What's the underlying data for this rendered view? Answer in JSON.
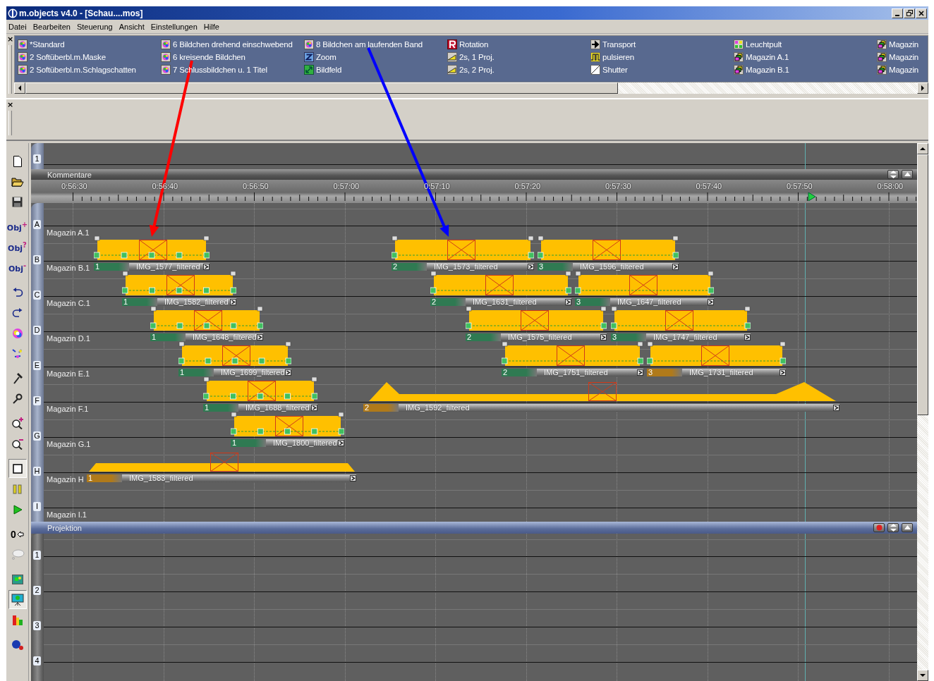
{
  "window": {
    "title": "m.objects v4.0 - [Schau....mos]"
  },
  "menu": [
    "Datei",
    "Bearbeiten",
    "Steuerung",
    "Ansicht",
    "Einstellungen",
    "Hilfe"
  ],
  "palette": {
    "close": "×",
    "columns": [
      [
        {
          "label": "*Standard"
        },
        {
          "label": "2 Softüberbl.m.Maske"
        },
        {
          "label": "2 Softüberbl.m.Schlagschatten"
        }
      ],
      [
        {
          "label": "6 Bildchen drehend einschwebend"
        },
        {
          "label": "6 kreisende Bildchen"
        },
        {
          "label": "7 Schlussbildchen u. 1 Titel"
        }
      ],
      [
        {
          "label": "8 Bildchen am laufenden Band"
        },
        {
          "label": "Zoom"
        },
        {
          "label": "Bildfeld"
        }
      ],
      [
        {
          "label": "Rotation"
        },
        {
          "label": "2s, 1 Proj."
        },
        {
          "label": "2s, 2 Proj."
        }
      ],
      [
        {
          "label": "Transport"
        },
        {
          "label": "pulsieren"
        },
        {
          "label": "Shutter"
        }
      ],
      [
        {
          "label": "Leuchtpult"
        },
        {
          "label": "Magazin A.1"
        },
        {
          "label": "Magazin B.1"
        }
      ],
      [
        {
          "label": "Magazin"
        },
        {
          "label": "Magazin"
        },
        {
          "label": "Magazin"
        }
      ]
    ]
  },
  "panel": {
    "close": "×"
  },
  "toolbar": [
    {
      "selected": false
    },
    {
      "selected": false
    },
    {
      "selected": false
    },
    {
      "label": "Obj$^{+}$",
      "selected": false
    },
    {
      "label": "Obj$^{?}$",
      "selected": false
    },
    {
      "label": "Obj$^{-}$",
      "selected": false
    },
    {
      "selected": false
    },
    {
      "selected": false
    },
    {
      "selected": false
    },
    {
      "selected": false
    },
    {
      "selected": false
    },
    {
      "selected": false
    },
    {
      "selected": false
    },
    {
      "selected": false
    },
    {
      "selected": true
    },
    {
      "selected": false
    },
    {
      "selected": false
    },
    {
      "label": "0",
      "selected": false
    },
    {
      "selected": false
    },
    {
      "selected": false
    },
    {
      "selected": true
    },
    {
      "selected": false
    },
    {
      "selected": false
    }
  ],
  "comments": {
    "lane": "1",
    "title": "Kommentare"
  },
  "ruler": {
    "labels": [
      "0:56:30",
      "0:56:40",
      "0:56:50",
      "0:57:00",
      "0:57:10",
      "0:57:20",
      "0:57:30",
      "0:57:40",
      "0:57:50",
      "0:58:00"
    ]
  },
  "tracks": [
    {
      "letter": "A",
      "label": "Magazin A.1"
    },
    {
      "letter": "B",
      "label": "Magazin B.1",
      "clips": [
        {
          "kind": "pan",
          "number": "1",
          "name": "IMG_1577_filtered",
          "color": "#2f7a52"
        },
        {
          "kind": "still",
          "number": "2",
          "name": "IMG_1573_filtered",
          "color": "#2f7a52"
        },
        {
          "kind": "still",
          "number": "3",
          "name": "IMG_1596_filtered",
          "color": "#2f7a52"
        }
      ]
    },
    {
      "letter": "C",
      "label": "Magazin C.1",
      "clips": [
        {
          "kind": "pan",
          "number": "1",
          "name": "IMG_1582_filtered",
          "color": "#2f7a52"
        },
        {
          "kind": "still",
          "number": "2",
          "name": "IMG_1631_filtered",
          "color": "#2f7a52"
        },
        {
          "kind": "still",
          "number": "3",
          "name": "IMG_1647_filtered",
          "color": "#2f7a52"
        }
      ]
    },
    {
      "letter": "D",
      "label": "Magazin D.1",
      "clips": [
        {
          "kind": "pan",
          "number": "1",
          "name": "IMG_1648_filtered",
          "color": "#2f7a52"
        },
        {
          "kind": "still",
          "number": "2",
          "name": "IMG_1575_filtered",
          "color": "#2f7a52"
        },
        {
          "kind": "still",
          "number": "3",
          "name": "IMG_1747_filtered",
          "color": "#2f7a52"
        }
      ]
    },
    {
      "letter": "E",
      "label": "Magazin E.1",
      "clips": [
        {
          "kind": "pan",
          "number": "1",
          "name": "IMG_1699_filtered",
          "color": "#2f7a52"
        },
        {
          "kind": "still",
          "number": "2",
          "name": "IMG_1751_filtered",
          "color": "#2f7a52"
        },
        {
          "kind": "still",
          "number": "3",
          "name": "IMG_1731_filtered",
          "color": "#b07a1a"
        }
      ]
    },
    {
      "letter": "F",
      "label": "Magazin F.1",
      "clips": [
        {
          "kind": "pan",
          "number": "1",
          "name": "IMG_1688_filtered",
          "color": "#2f7a52"
        },
        {
          "kind": "ramp",
          "number": "2",
          "name": "IMG_1592_filtered",
          "color": "#b07a1a"
        }
      ]
    },
    {
      "letter": "G",
      "label": "Magazin G.1",
      "clips": [
        {
          "kind": "pan",
          "number": "1",
          "name": "IMG_1800_filtered",
          "color": "#2f7a52"
        }
      ]
    },
    {
      "letter": "H",
      "label": "Magazin H",
      "clips": [
        {
          "kind": "flat",
          "number": "1",
          "name": "IMG_1583_filtered",
          "color": "#b07a1a"
        }
      ]
    },
    {
      "letter": "I",
      "label": "Magazin I.1"
    }
  ],
  "projection": {
    "title": "Projektion",
    "lanes": [
      "1",
      "2",
      "3",
      "4"
    ]
  },
  "annotations": [
    {
      "color": "#ff0000"
    },
    {
      "color": "#0000ff"
    }
  ]
}
